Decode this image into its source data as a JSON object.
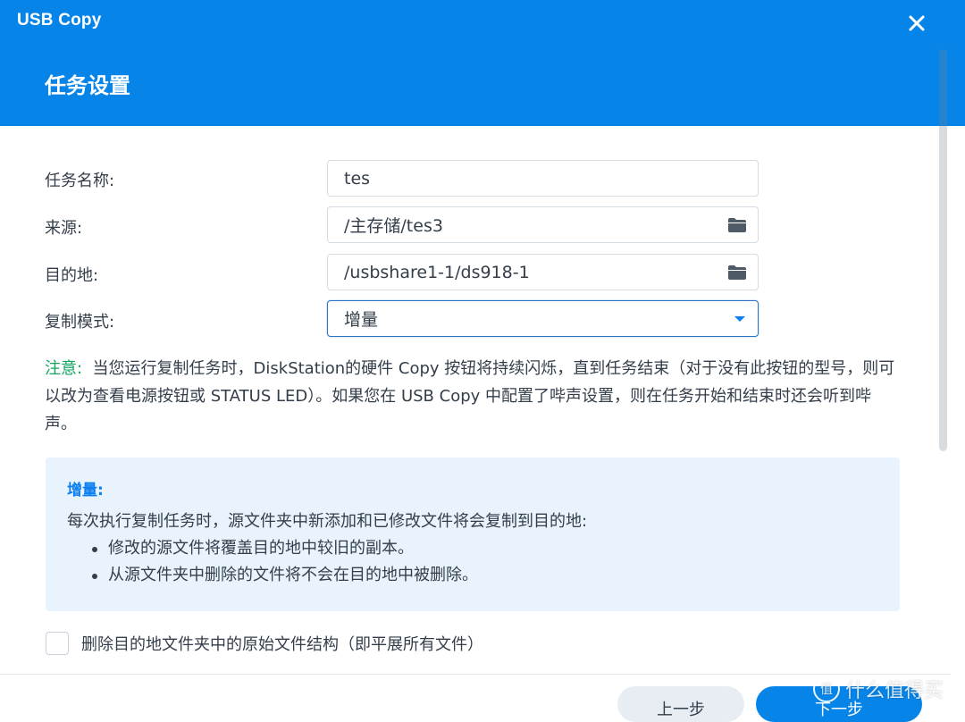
{
  "window": {
    "app_title": "USB Copy",
    "page_title": "任务设置"
  },
  "form": {
    "task_name": {
      "label": "任务名称:",
      "value": "tes"
    },
    "source": {
      "label": "来源:",
      "value": "/主存储/tes3"
    },
    "destination": {
      "label": "目的地:",
      "value": "/usbshare1-1/ds918-1"
    },
    "copy_mode": {
      "label": "复制模式:",
      "value": "增量"
    }
  },
  "note": {
    "label": "注意:",
    "text": "当您运行复制任务时，DiskStation的硬件 Copy 按钮将持续闪烁，直到任务结束（对于没有此按钮的型号，则可以改为查看电源按钮或 STATUS LED）。如果您在 USB Copy 中配置了哔声设置，则在任务开始和结束时还会听到哔声。"
  },
  "info_box": {
    "title": "增量:",
    "description": "每次执行复制任务时，源文件夹中新添加和已修改文件将会复制到目的地:",
    "items": [
      "修改的源文件将覆盖目的地中较旧的副本。",
      "从源文件夹中删除的文件将不会在目的地中被删除。"
    ]
  },
  "checkbox": {
    "label": "删除目的地文件夹中的原始文件结构（即平展所有文件）",
    "checked": false
  },
  "buttons": {
    "prev": "上一步",
    "next": "下一步"
  },
  "watermark": {
    "text": "什么值得买"
  },
  "colors": {
    "header": "#0784e8",
    "note_label": "#12a55f",
    "info_title": "#0b7ff0",
    "info_bg": "#e8f3fe",
    "select_border": "#2d73c4"
  },
  "icons": {
    "close": "close-icon",
    "folder": "folder-icon",
    "dropdown": "caret-down-icon"
  }
}
